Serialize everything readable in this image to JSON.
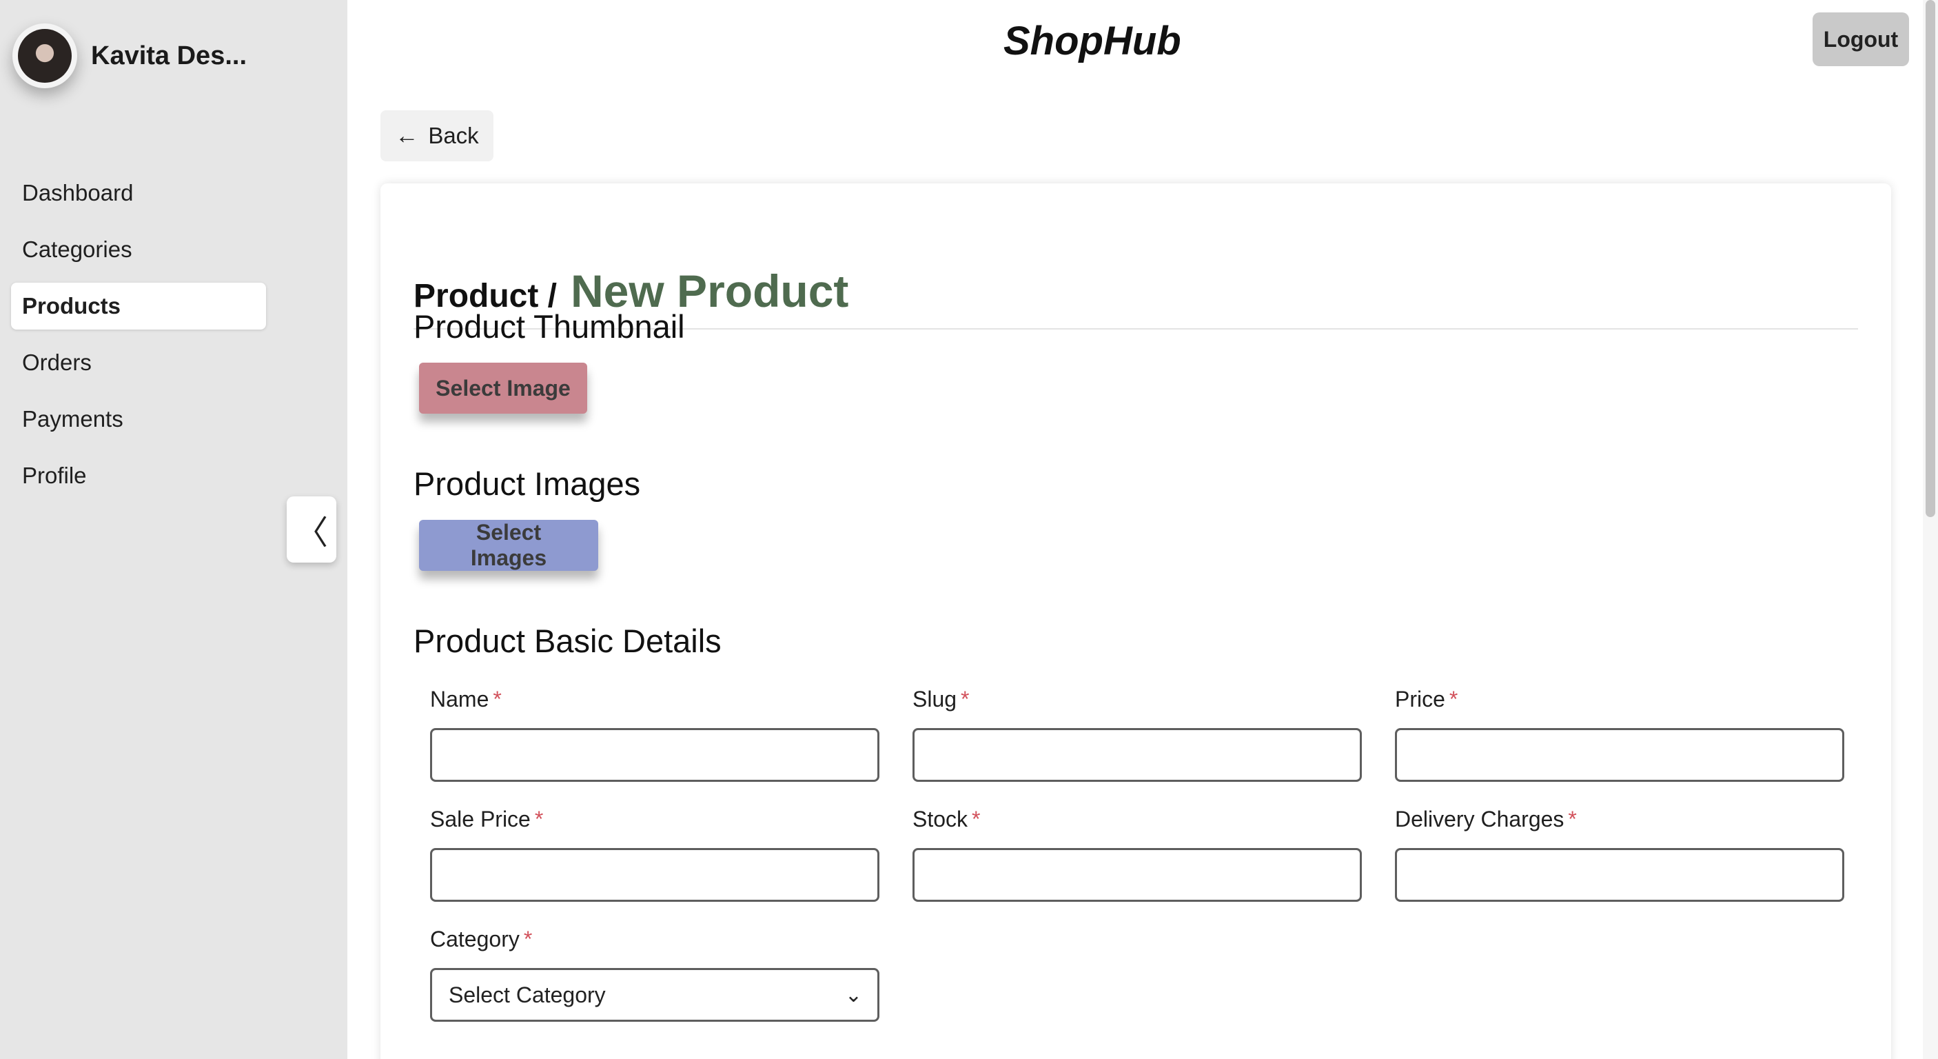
{
  "user": {
    "name": "Kavita Des...",
    "avatar_icon": "avatar-photo"
  },
  "sidebar": {
    "items": [
      {
        "label": "Dashboard"
      },
      {
        "label": "Categories"
      },
      {
        "label": "Products",
        "active": true
      },
      {
        "label": "Orders"
      },
      {
        "label": "Payments"
      },
      {
        "label": "Profile"
      }
    ],
    "collapse_glyph": "〈"
  },
  "header": {
    "brand": "ShopHub",
    "logout_label": "Logout"
  },
  "back": {
    "label": "Back",
    "arrow": "←"
  },
  "page": {
    "breadcrumb": "Product /",
    "title": "New Product",
    "title_color": "#4f6b4f"
  },
  "thumbnail": {
    "title": "Product Thumbnail",
    "button_label": "Select Image",
    "button_color": "#c9868f"
  },
  "images": {
    "title": "Product Images",
    "button_label": "Select Images",
    "button_color": "#8e9ad0"
  },
  "basic": {
    "title": "Product Basic Details",
    "required_marker": "*",
    "fields": [
      {
        "label": "Name",
        "value": ""
      },
      {
        "label": "Slug",
        "value": ""
      },
      {
        "label": "Price",
        "value": ""
      },
      {
        "label": "Sale Price",
        "value": ""
      },
      {
        "label": "Stock",
        "value": ""
      },
      {
        "label": "Delivery Charges",
        "value": ""
      }
    ],
    "category": {
      "label": "Category",
      "selected": "Select Category",
      "chevron": "⌄"
    }
  }
}
